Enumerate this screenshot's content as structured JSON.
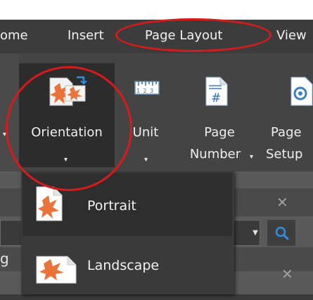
{
  "tabs": [
    {
      "label": "ome"
    },
    {
      "label": "Insert"
    },
    {
      "label": "Page Layout"
    },
    {
      "label": "View"
    }
  ],
  "ribbon": {
    "orientation": {
      "label": "Orientation",
      "icon": "orientation-icon"
    },
    "unit": {
      "label": "Unit",
      "icon": "ruler-icon"
    },
    "page_number": {
      "line1": "Page",
      "line2": "Number"
    },
    "page_setup": {
      "line1": "Page",
      "line2": "Setup"
    }
  },
  "dropdown": {
    "items": [
      {
        "label": "Portrait",
        "icon": "portrait-page-icon"
      },
      {
        "label": "Landscape",
        "icon": "landscape-page-icon"
      }
    ]
  },
  "partial_row_text": "g",
  "colors": {
    "annotation": "#d71a1a",
    "icon_orange": "#e9733a",
    "search_blue": "#2f8fe0"
  }
}
